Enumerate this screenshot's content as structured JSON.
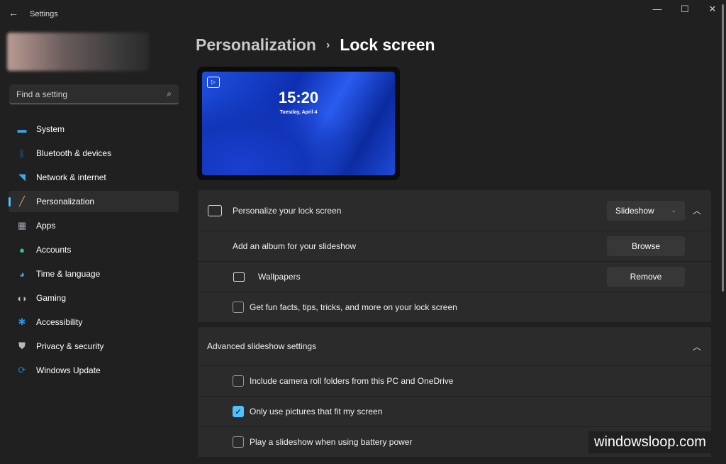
{
  "window": {
    "title": "Settings",
    "back": "←",
    "minimize": "—",
    "maximize": "☐",
    "close": "✕"
  },
  "search": {
    "placeholder": "Find a setting",
    "icon": "⌕"
  },
  "sidebar": {
    "items": [
      {
        "label": "System",
        "icon": "monitor-icon",
        "color": "#3aa0e0"
      },
      {
        "label": "Bluetooth & devices",
        "icon": "bluetooth-icon",
        "color": "#1a7fe0"
      },
      {
        "label": "Network & internet",
        "icon": "wifi-icon",
        "color": "#3aa8f0"
      },
      {
        "label": "Personalization",
        "icon": "brush-icon",
        "color": "#e0a060",
        "active": true
      },
      {
        "label": "Apps",
        "icon": "apps-icon",
        "color": "#a0a8b8"
      },
      {
        "label": "Accounts",
        "icon": "person-icon",
        "color": "#30c0a0"
      },
      {
        "label": "Time & language",
        "icon": "globe-clock-icon",
        "color": "#3aa0e0"
      },
      {
        "label": "Gaming",
        "icon": "gamepad-icon",
        "color": "#b0b8c8"
      },
      {
        "label": "Accessibility",
        "icon": "accessibility-icon",
        "color": "#2a90e0"
      },
      {
        "label": "Privacy & security",
        "icon": "shield-icon",
        "color": "#b8b8b8"
      },
      {
        "label": "Windows Update",
        "icon": "update-icon",
        "color": "#1a7fe0"
      }
    ]
  },
  "breadcrumb": {
    "parent": "Personalization",
    "separator": "›",
    "current": "Lock screen"
  },
  "preview": {
    "time": "15:20",
    "date": "Tuesday, April 4"
  },
  "lock_card": {
    "header": "Personalize your lock screen",
    "dropdown_value": "Slideshow",
    "album_label": "Add an album for your slideshow",
    "browse": "Browse",
    "folder": "Wallpapers",
    "remove": "Remove",
    "fun_facts": "Get fun facts, tips, tricks, and more on your lock screen",
    "fun_facts_checked": false
  },
  "advanced": {
    "header": "Advanced slideshow settings",
    "options": [
      {
        "label": "Include camera roll folders from this PC and OneDrive",
        "checked": false
      },
      {
        "label": "Only use pictures that fit my screen",
        "checked": true
      },
      {
        "label": "Play a slideshow when using battery power",
        "checked": false
      }
    ]
  },
  "watermark": "windowsloop.com"
}
